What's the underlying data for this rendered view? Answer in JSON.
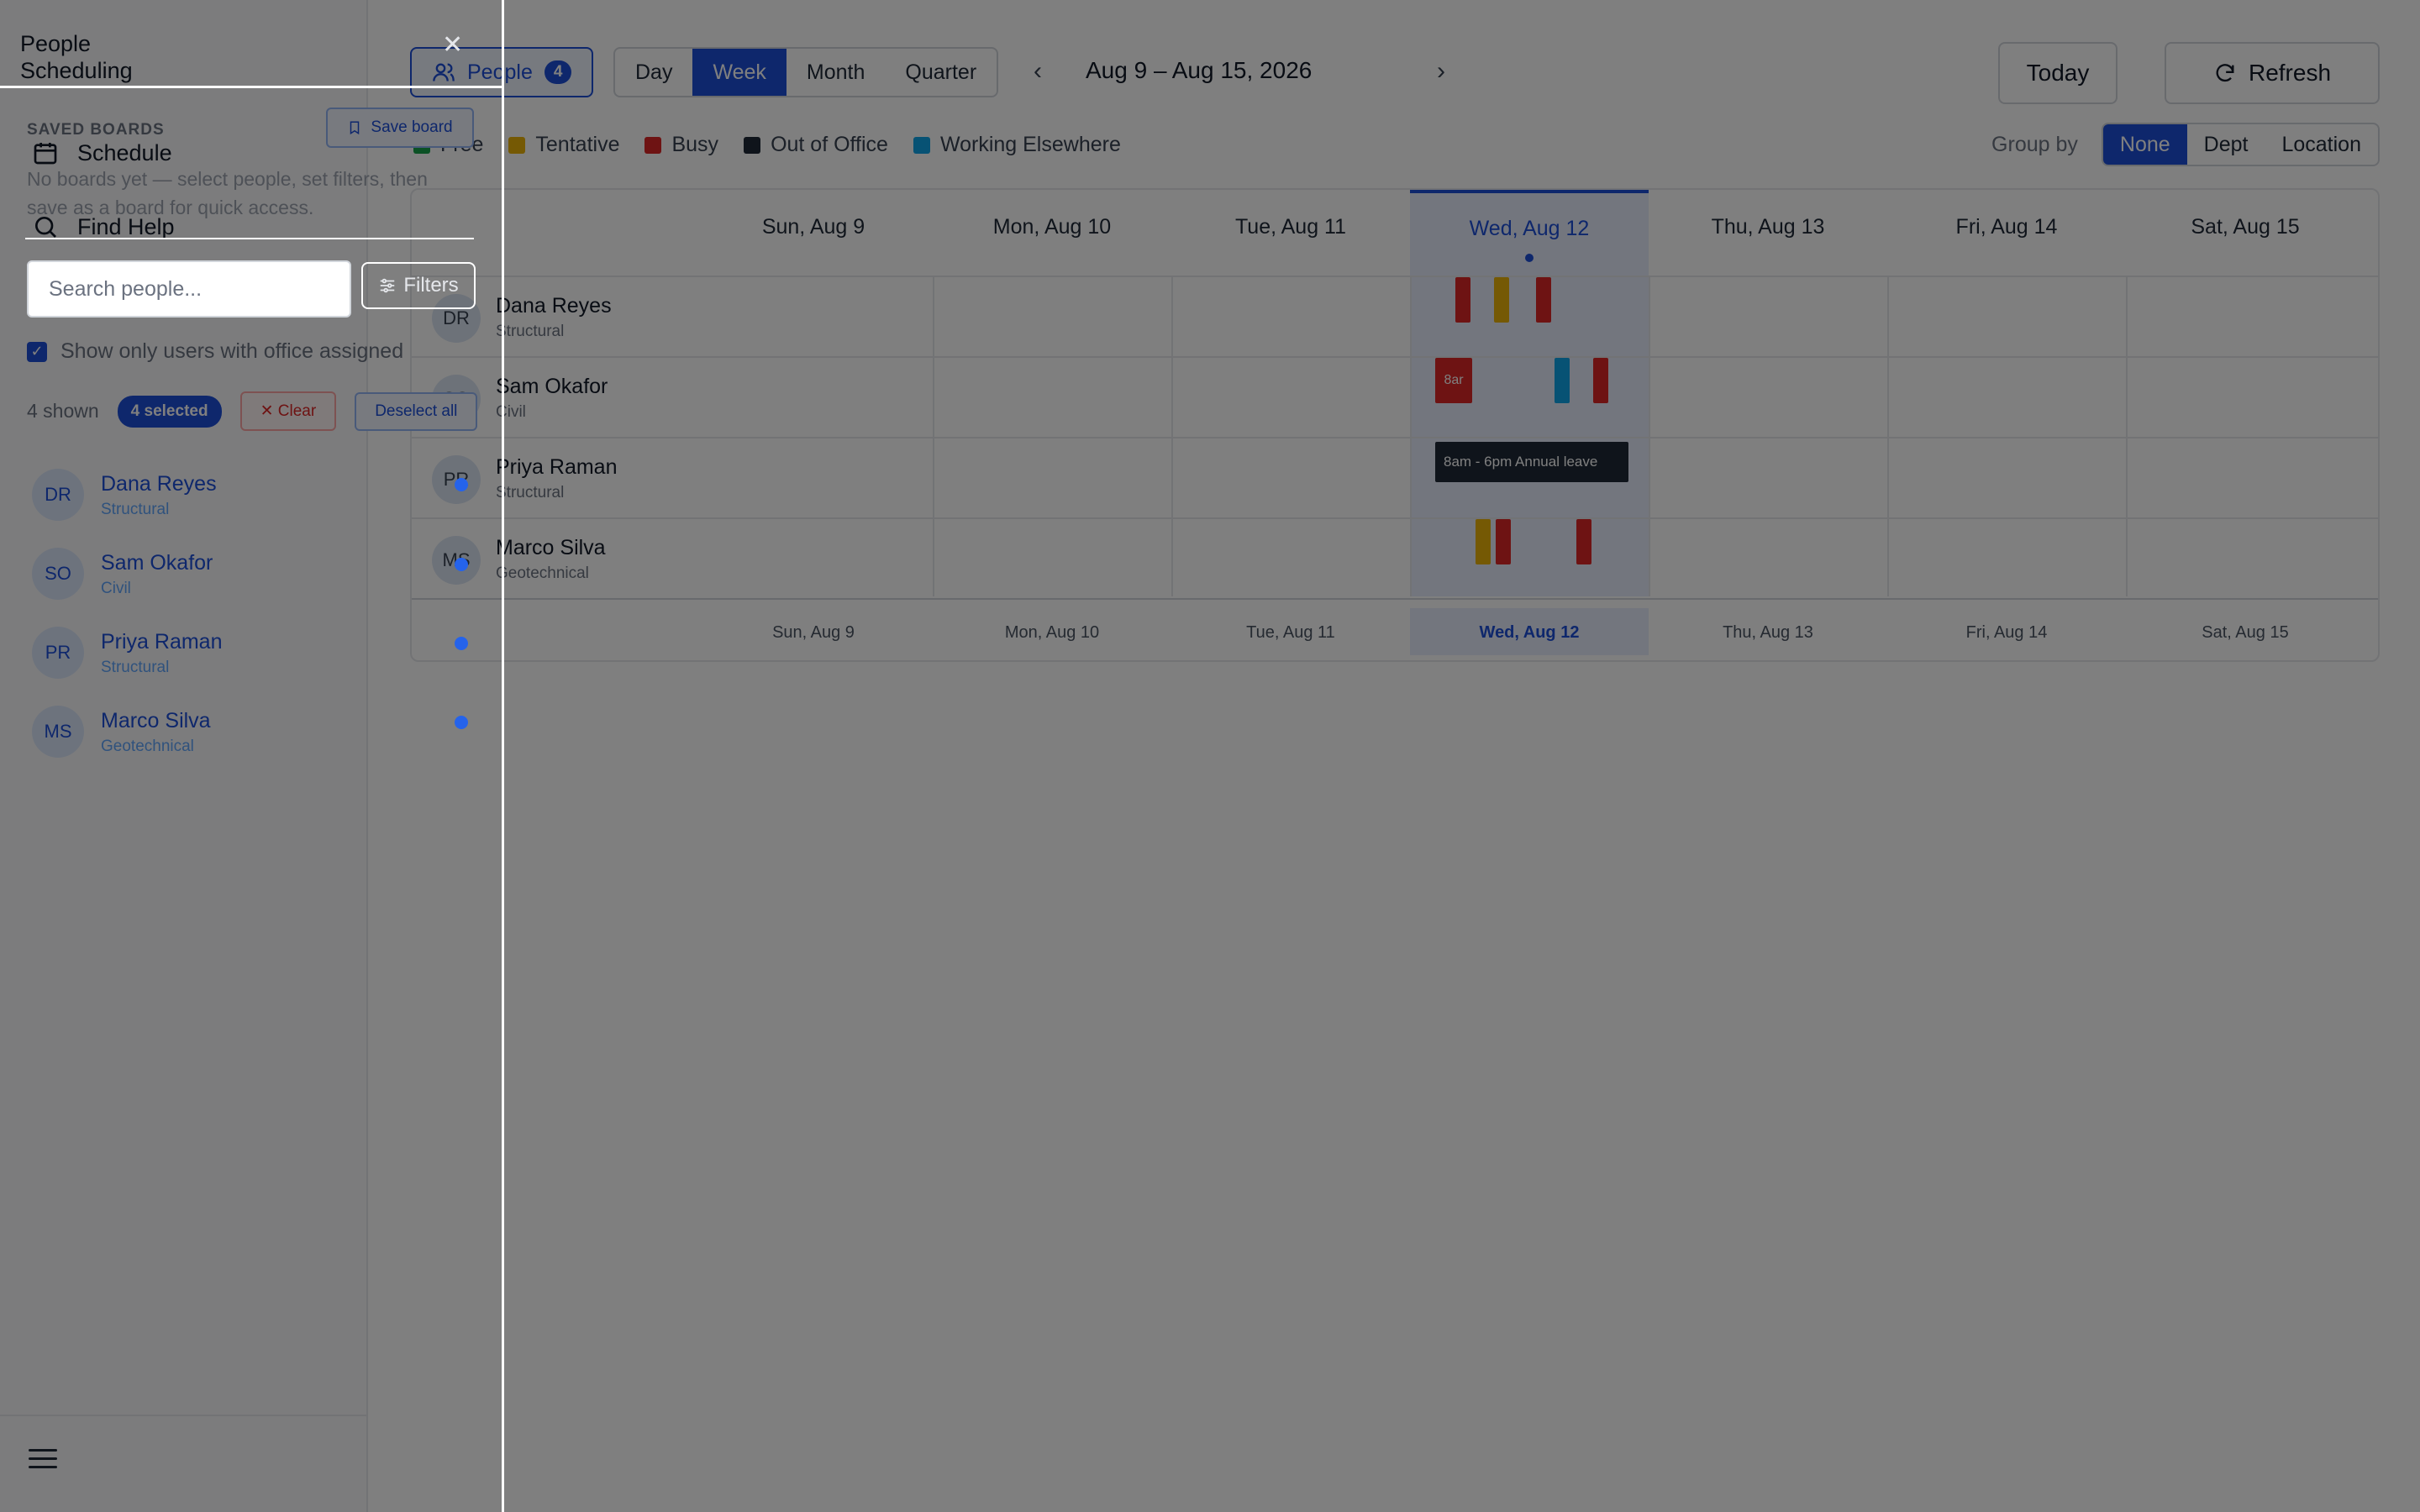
{
  "app": {
    "brand_line1": "People",
    "brand_line2": "Scheduling"
  },
  "nav": {
    "schedule": "Schedule",
    "find_help": "Find Help",
    "schedule_icon": "calendar-icon",
    "help_icon": "search-icon",
    "menu_icon": "hamburger-icon"
  },
  "toolbar": {
    "people_label": "People",
    "people_count": "4",
    "views": [
      "Day",
      "Week",
      "Month",
      "Quarter"
    ],
    "active_view": "Week",
    "range": "Aug 9 – Aug 15, 2026",
    "today": "Today",
    "refresh": "Refresh"
  },
  "legend": [
    {
      "label": "Free",
      "color": "#16a34a"
    },
    {
      "label": "Tentative",
      "color": "#eab308"
    },
    {
      "label": "Busy",
      "color": "#dc2626"
    },
    {
      "label": "Out of Office",
      "color": "#1f2937"
    },
    {
      "label": "Working Elsewhere",
      "color": "#0ea5e9"
    }
  ],
  "group_by": {
    "label": "Group by",
    "options": [
      "None",
      "Dept",
      "Location"
    ],
    "active": "None"
  },
  "days": [
    "Sun, Aug 9",
    "Mon, Aug 10",
    "Tue, Aug 11",
    "Wed, Aug 12",
    "Thu, Aug 13",
    "Fri, Aug 14",
    "Sat, Aug 15"
  ],
  "today_index": 3,
  "people": [
    {
      "initials": "DR",
      "name": "Dana Reyes",
      "dept": "Structural"
    },
    {
      "initials": "SO",
      "name": "Sam Okafor",
      "dept": "Civil"
    },
    {
      "initials": "PR",
      "name": "Priya Raman",
      "dept": "Structural"
    },
    {
      "initials": "MS",
      "name": "Marco Silva",
      "dept": "Geotechnical"
    }
  ],
  "events": {
    "sam_busy_label": "8ar",
    "priya_ooo_label": "8am - 6pm Annual leave"
  },
  "drawer": {
    "saved_boards_title": "SAVED BOARDS",
    "save_board": "Save board",
    "empty_message": "No boards yet — select people, set filters, then save as a board for quick access.",
    "search_placeholder": "Search people...",
    "filters": "Filters",
    "office_only_label": "Show only users with office assigned",
    "office_only_checked": true,
    "shown_text": "4 shown",
    "selected_text": "4 selected",
    "clear": "Clear",
    "deselect": "Deselect all",
    "close_icon": "close-icon"
  }
}
